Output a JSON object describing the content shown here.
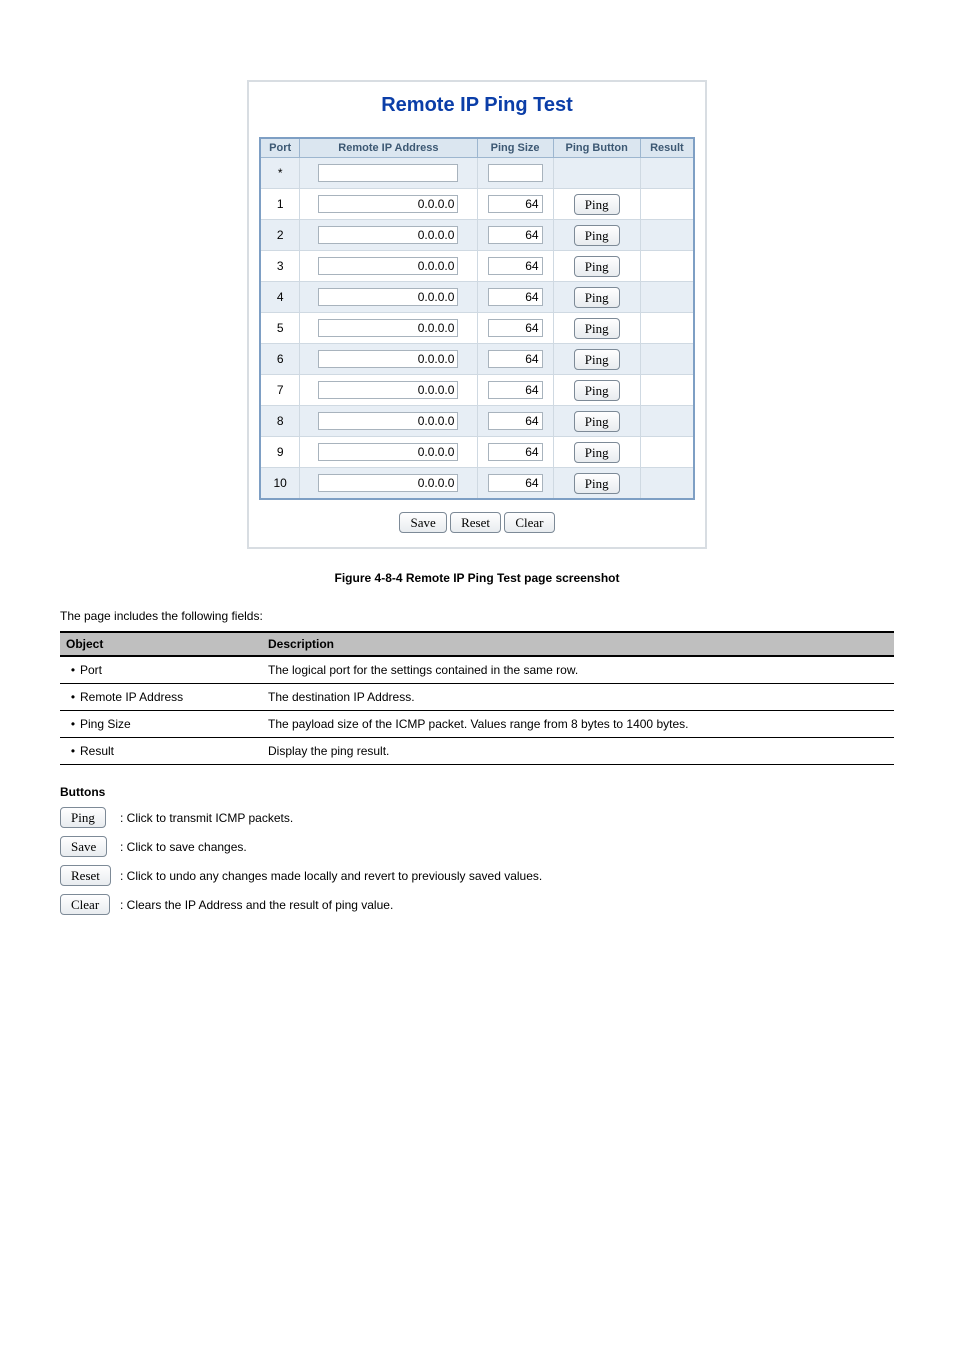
{
  "panel": {
    "title": "Remote IP Ping Test",
    "columns": [
      "Port",
      "Remote IP Address",
      "Ping Size",
      "Ping Button",
      "Result"
    ],
    "head_row_port": "*",
    "rows": [
      {
        "port": "1",
        "ip": "0.0.0.0",
        "size": "64"
      },
      {
        "port": "2",
        "ip": "0.0.0.0",
        "size": "64"
      },
      {
        "port": "3",
        "ip": "0.0.0.0",
        "size": "64"
      },
      {
        "port": "4",
        "ip": "0.0.0.0",
        "size": "64"
      },
      {
        "port": "5",
        "ip": "0.0.0.0",
        "size": "64"
      },
      {
        "port": "6",
        "ip": "0.0.0.0",
        "size": "64"
      },
      {
        "port": "7",
        "ip": "0.0.0.0",
        "size": "64"
      },
      {
        "port": "8",
        "ip": "0.0.0.0",
        "size": "64"
      },
      {
        "port": "9",
        "ip": "0.0.0.0",
        "size": "64"
      },
      {
        "port": "10",
        "ip": "0.0.0.0",
        "size": "64"
      }
    ],
    "ping_label": "Ping",
    "buttons": {
      "save": "Save",
      "reset": "Reset",
      "clear": "Clear"
    }
  },
  "figure_caption": "Figure 4-8-4 Remote IP Ping Test page screenshot",
  "description_intro": "The page includes the following fields:",
  "objects_table": {
    "head": [
      "Object",
      "Description"
    ],
    "rows": [
      {
        "obj": "Port",
        "desc": "The logical port for the settings contained in the same row."
      },
      {
        "obj": "Remote IP Address",
        "desc": "The destination IP Address."
      },
      {
        "obj": "Ping Size",
        "desc": "The payload size of the ICMP packet. Values range from 8 bytes to 1400 bytes."
      },
      {
        "obj": "Result",
        "desc": "Display the ping result."
      }
    ]
  },
  "buttons_section": {
    "title": "Buttons",
    "rows": [
      {
        "btn": "Ping",
        "text": ": Click to transmit ICMP packets."
      },
      {
        "btn": "Save",
        "text": ": Click to save changes."
      },
      {
        "btn": "Reset",
        "text": ": Click to undo any changes made locally and revert to previously saved values."
      },
      {
        "btn": "Clear",
        "text": ": Clears the IP Address and the result of ping value."
      }
    ]
  }
}
